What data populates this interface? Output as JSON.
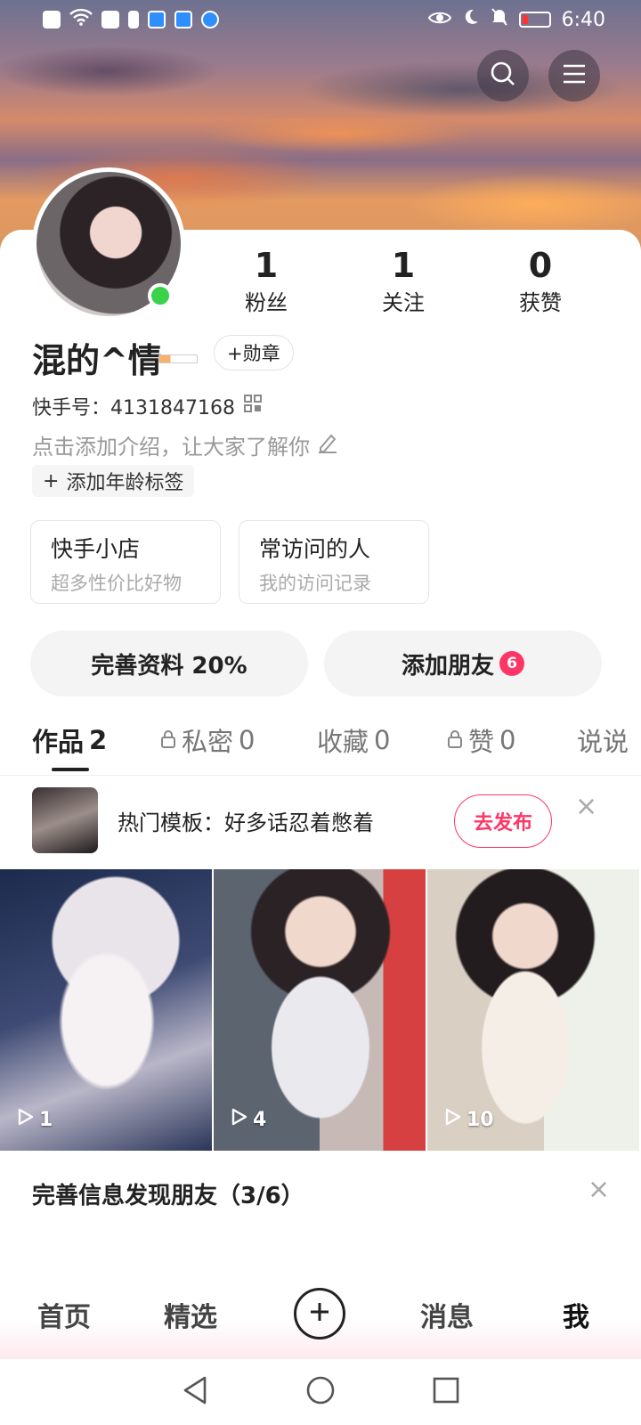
{
  "status_bar": {
    "time": "6:40"
  },
  "profile": {
    "name": "混的^情",
    "medal_label": "+勋章",
    "kuaishou_id": "快手号：4131847168",
    "intro_placeholder": "点击添加介绍，让大家了解你",
    "age_tag_label": "添加年龄标签",
    "stats": [
      {
        "value": "1",
        "label": "粉丝"
      },
      {
        "value": "1",
        "label": "关注"
      },
      {
        "value": "0",
        "label": "获赞"
      }
    ]
  },
  "shortcuts": [
    {
      "title": "快手小店",
      "subtitle": "超多性价比好物"
    },
    {
      "title": "常访问的人",
      "subtitle": "我的访问记录"
    }
  ],
  "actions": {
    "complete_profile": "完善资料 20%",
    "add_friends": "添加朋友",
    "add_friends_badge": "6"
  },
  "tabs": [
    {
      "label": "作品",
      "count": "2",
      "locked": false,
      "active": true
    },
    {
      "label": "私密",
      "count": "0",
      "locked": true,
      "active": false
    },
    {
      "label": "收藏",
      "count": "0",
      "locked": false,
      "active": false
    },
    {
      "label": "赞",
      "count": "0",
      "locked": true,
      "active": false
    },
    {
      "label": "说说",
      "count": "",
      "locked": false,
      "active": false
    }
  ],
  "template_banner": {
    "text": "热门模板：好多话忍着憋着",
    "button": "去发布"
  },
  "videos": [
    {
      "plays": "1"
    },
    {
      "plays": "4"
    },
    {
      "plays": "10"
    }
  ],
  "suggestion": {
    "title": "完善信息发现朋友（3/6）"
  },
  "bottom_nav": {
    "home": "首页",
    "featured": "精选",
    "messages": "消息",
    "me": "我"
  },
  "colors": {
    "accent": "#fe3666",
    "online": "#3bd24b"
  },
  "icons": [
    "search-icon",
    "menu-icon",
    "qr-code-icon",
    "edit-icon",
    "lock-icon",
    "close-icon",
    "play-icon",
    "plus-icon",
    "back-icon",
    "home-circle-icon",
    "recents-icon"
  ]
}
